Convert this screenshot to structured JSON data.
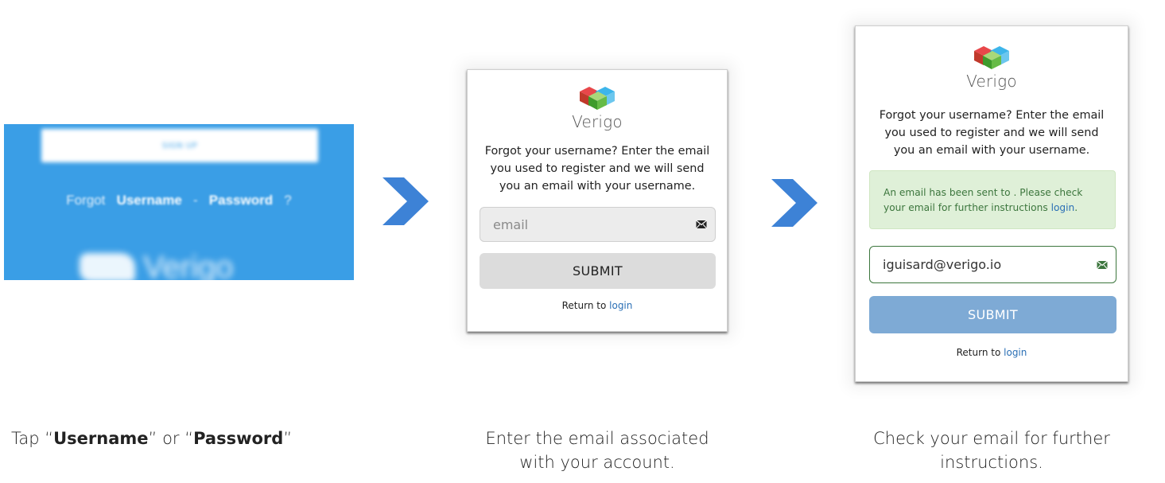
{
  "step1": {
    "signup_label": "SIGN UP",
    "forgot_prefix": "Forgot",
    "username_link": "Username",
    "separator": "-",
    "password_link": "Password",
    "question_mark": "?",
    "brand_text": "Verigo"
  },
  "step2": {
    "brand_name": "Verigo",
    "instruction_line1": "Forgot your username? Enter the email",
    "instruction_line2": "you used to register and we will send",
    "instruction_line3": "you an email with your username.",
    "email_placeholder": "email",
    "submit_label": "SUBMIT",
    "return_prefix": "Return to",
    "login_link": "login"
  },
  "step3": {
    "brand_name": "Verigo",
    "instruction_line1": "Forgot your username? Enter the email",
    "instruction_line2": "you used to register and we will send",
    "instruction_line3": "you an email with your username.",
    "alert_line1": "An email has been sent to . Please check",
    "alert_line2_prefix": "your email for further instructions",
    "alert_login_link": "login",
    "alert_period": ".",
    "email_value": "iguisard@verigo.io",
    "submit_label": "SUBMIT",
    "return_prefix": "Return to",
    "login_link": "login"
  },
  "captions": {
    "step1_prefix": "Tap “",
    "step1_username": "Username",
    "step1_mid": "” or “",
    "step1_password": "Password",
    "step1_suffix": "”",
    "step2_line1": "Enter the email associated",
    "step2_line2": "with your account.",
    "step3_line1": "Check your email for further",
    "step3_line2": "instructions."
  },
  "colors": {
    "banner_blue": "#3a9ee6",
    "chevron_blue": "#3d82d6",
    "submit_disabled": "#dcdcdc",
    "submit_active": "#7eaad5",
    "field_success_border": "#3c763d",
    "alert_bg": "#dff0d8",
    "link_blue": "#2a6fb5"
  }
}
